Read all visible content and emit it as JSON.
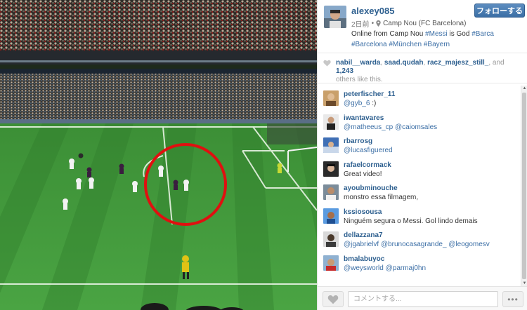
{
  "post": {
    "owner": "alexey085",
    "follow_label": "フォローする",
    "time_ago": "2日前",
    "separator": "•",
    "location": "Camp Nou (FC Barcelona)",
    "caption": {
      "text_1": "Online from Camp Nou ",
      "tag_1": "#Messi",
      "text_2": " is God ",
      "tag_2": "#Barca",
      "tag_3": "#Barcelona",
      "tag_4": "#München",
      "tag_5": "#Bayern"
    }
  },
  "likes": {
    "user_1": "nabil__warda",
    "user_2": "saad.qudah",
    "user_3": "racz_majesz_still_",
    "sep": ",",
    "and_text": " and ",
    "count": "1,243",
    "suffix": "others like this."
  },
  "comments": [
    {
      "user": "peterfischer_11",
      "text": "@gyb_6 :)"
    },
    {
      "user": "iwantavares",
      "text": "@matheeus_cp @caiomsales"
    },
    {
      "user": "rbarrosg",
      "text": "@lucasfiguered"
    },
    {
      "user": "rafaelcormack",
      "text": "Great video!"
    },
    {
      "user": "ayoubminouche",
      "text": "monstro essa filmagem,"
    },
    {
      "user": "kssiosousa",
      "text": "Ninguém segura o Messi. Gol lindo demais"
    },
    {
      "user": "dellazzana7",
      "text": "@jgabrielvf @brunocasagrande_ @leogomesv"
    },
    {
      "user": "bmalabuyoc",
      "text": "@weysworld @parmaj0hn"
    }
  ],
  "footer": {
    "comment_placeholder": "コメントする...",
    "more_label": "•••"
  },
  "icons": {
    "heart": "heart-icon",
    "pin": "location-pin-icon"
  },
  "colors": {
    "link": "#2d5f8f",
    "hashtag": "#3b6ea5",
    "follow_button": "#3a6ea5",
    "pitch": "#3f9a3a",
    "annotation_circle": "#e01010"
  }
}
